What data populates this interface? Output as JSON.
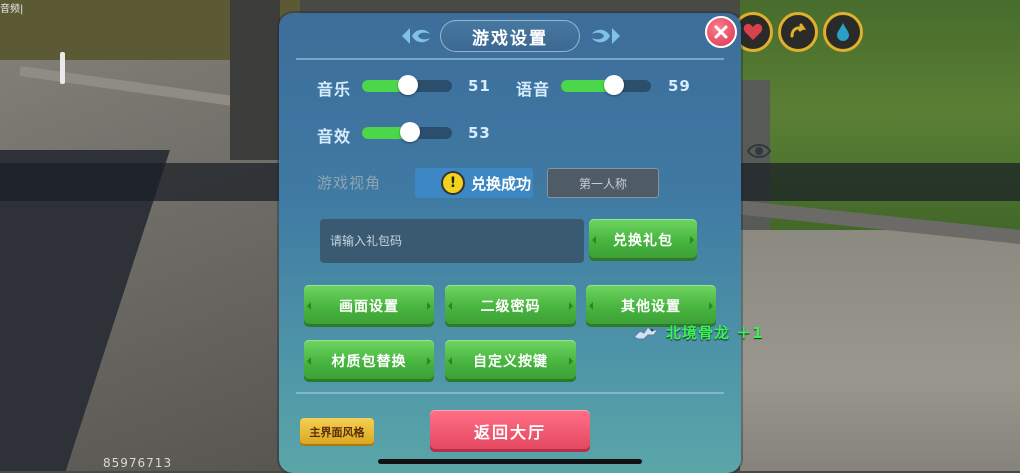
{
  "hud": {
    "top_left_text": "音频|",
    "player_id": "85976713"
  },
  "dialog": {
    "title": "游戏设置",
    "sliders": [
      {
        "label": "音乐",
        "value": "51",
        "level": 0.51
      },
      {
        "label": "语音",
        "value": "59",
        "level": 0.59
      },
      {
        "label": "音效",
        "value": "53",
        "level": 0.53
      }
    ],
    "view": {
      "label": "游戏视角",
      "option_third": "",
      "option_first": "第一人称"
    },
    "toast": {
      "icon": "!",
      "text": "兑换成功"
    },
    "gift": {
      "placeholder": "请输入礼包码",
      "button": "兑换礼包"
    },
    "buttons": {
      "graphics": "画面设置",
      "secondary_password": "二级密码",
      "other": "其他设置",
      "texture_pack": "材质包替换",
      "custom_keys": "自定义按键"
    },
    "footer": {
      "ui_style": "主界面风格",
      "return_lobby": "返回大厅"
    }
  },
  "reward": {
    "text": "北境骨龙 ＋1"
  },
  "colors": {
    "panel": "#3f7aa3",
    "slider_fill": "#4cd64a",
    "green_button": "#46b43e",
    "red_button": "#e2465e",
    "yellow_button": "#d9a51e",
    "reward_text": "#3df05a",
    "ring_border": "#e0b02a"
  },
  "icons": [
    "close-icon",
    "heart-icon",
    "swap-arrow-icon",
    "water-drop-icon",
    "eye-icon",
    "warning-icon",
    "bone-dragon-icon"
  ]
}
